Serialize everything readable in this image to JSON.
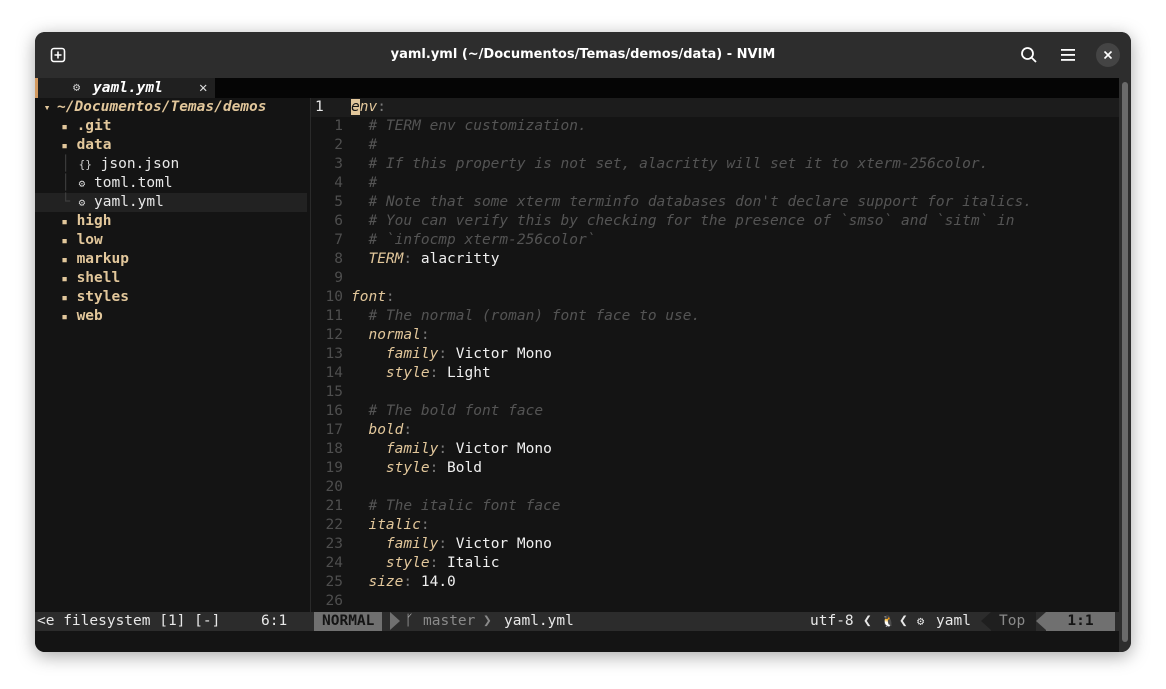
{
  "window": {
    "title": "yaml.yml (~/Documentos/Temas/demos/data) - NVIM"
  },
  "titlebar_icons": {
    "new_tab": "new-tab-icon",
    "search": "search-icon",
    "menu": "hamburger-menu-icon",
    "close": "close-icon"
  },
  "tab": {
    "icon": "⚙",
    "label": "yaml.yml",
    "close": "✕"
  },
  "tree": {
    "root": "~/Documentos/Temas/demos",
    "items": [
      {
        "indent": "  ",
        "icon": "▪",
        "label": ".git",
        "type": "folder"
      },
      {
        "indent": "  ",
        "icon": "▪",
        "label": "data",
        "type": "folder"
      },
      {
        "indent": "  │ ",
        "icon": "{}",
        "label": "json.json",
        "type": "file"
      },
      {
        "indent": "  │ ",
        "icon": "⚙",
        "label": "toml.toml",
        "type": "file"
      },
      {
        "indent": "  └ ",
        "icon": "⚙",
        "label": "yaml.yml",
        "type": "file"
      },
      {
        "indent": "  ",
        "icon": "▪",
        "label": "high",
        "type": "folder"
      },
      {
        "indent": "  ",
        "icon": "▪",
        "label": "low",
        "type": "folder"
      },
      {
        "indent": "  ",
        "icon": "▪",
        "label": "markup",
        "type": "folder"
      },
      {
        "indent": "  ",
        "icon": "▪",
        "label": "shell",
        "type": "folder"
      },
      {
        "indent": "  ",
        "icon": "▪",
        "label": "styles",
        "type": "folder"
      },
      {
        "indent": "  ",
        "icon": "▪",
        "label": "web",
        "type": "folder"
      }
    ]
  },
  "editor": {
    "lines": [
      {
        "n": "1",
        "indent": "",
        "key": "env",
        "rest": "",
        "comment": ""
      },
      {
        "n": "1",
        "indent": "  ",
        "key": "",
        "rest": "",
        "comment": "# TERM env customization."
      },
      {
        "n": "2",
        "indent": "  ",
        "key": "",
        "rest": "",
        "comment": "#"
      },
      {
        "n": "3",
        "indent": "  ",
        "key": "",
        "rest": "",
        "comment": "# If this property is not set, alacritty will set it to xterm-256color."
      },
      {
        "n": "4",
        "indent": "  ",
        "key": "",
        "rest": "",
        "comment": "#"
      },
      {
        "n": "5",
        "indent": "  ",
        "key": "",
        "rest": "",
        "comment": "# Note that some xterm terminfo databases don't declare support for italics."
      },
      {
        "n": "6",
        "indent": "  ",
        "key": "",
        "rest": "",
        "comment": "# You can verify this by checking for the presence of `smso` and `sitm` in"
      },
      {
        "n": "7",
        "indent": "  ",
        "key": "",
        "rest": "",
        "comment": "# `infocmp xterm-256color`"
      },
      {
        "n": "8",
        "indent": "  ",
        "key": "TERM",
        "rest": "alacritty",
        "comment": ""
      },
      {
        "n": "9",
        "indent": "",
        "key": "",
        "rest": "",
        "comment": ""
      },
      {
        "n": "10",
        "indent": "",
        "key": "font",
        "rest": "",
        "comment": ""
      },
      {
        "n": "11",
        "indent": "  ",
        "key": "",
        "rest": "",
        "comment": "# The normal (roman) font face to use."
      },
      {
        "n": "12",
        "indent": "  ",
        "key": "normal",
        "rest": "",
        "comment": ""
      },
      {
        "n": "13",
        "indent": "    ",
        "key": "family",
        "rest": "Victor Mono",
        "comment": ""
      },
      {
        "n": "14",
        "indent": "    ",
        "key": "style",
        "rest": "Light",
        "comment": ""
      },
      {
        "n": "15",
        "indent": "",
        "key": "",
        "rest": "",
        "comment": ""
      },
      {
        "n": "16",
        "indent": "  ",
        "key": "",
        "rest": "",
        "comment": "# The bold font face"
      },
      {
        "n": "17",
        "indent": "  ",
        "key": "bold",
        "rest": "",
        "comment": ""
      },
      {
        "n": "18",
        "indent": "    ",
        "key": "family",
        "rest": "Victor Mono",
        "comment": ""
      },
      {
        "n": "19",
        "indent": "    ",
        "key": "style",
        "rest": "Bold",
        "comment": ""
      },
      {
        "n": "20",
        "indent": "",
        "key": "",
        "rest": "",
        "comment": ""
      },
      {
        "n": "21",
        "indent": "  ",
        "key": "",
        "rest": "",
        "comment": "# The italic font face"
      },
      {
        "n": "22",
        "indent": "  ",
        "key": "italic",
        "rest": "",
        "comment": ""
      },
      {
        "n": "23",
        "indent": "    ",
        "key": "family",
        "rest": "Victor Mono",
        "comment": ""
      },
      {
        "n": "24",
        "indent": "    ",
        "key": "style",
        "rest": "Italic",
        "comment": ""
      },
      {
        "n": "25",
        "indent": "  ",
        "key": "size",
        "rest": "14.0",
        "comment": ""
      },
      {
        "n": "26",
        "indent": "",
        "key": "",
        "rest": "",
        "comment": ""
      }
    ]
  },
  "statusline": {
    "left_file": "<e filesystem [1] [-]",
    "left_pos": "6:1",
    "mode": "NORMAL",
    "git_icon": "ᚴ",
    "branch": "master",
    "filename": "yaml.yml",
    "encoding": "utf-8",
    "os_icon": "🐧",
    "ft_icon": "⚙",
    "filetype": "yaml",
    "progress": "Top",
    "position": "1:1"
  },
  "colors": {
    "accent": "#e2c79b",
    "background": "#141414",
    "titlebar": "#2d2d2d",
    "comment": "#545454",
    "cursor_bar": "#d39a60"
  }
}
